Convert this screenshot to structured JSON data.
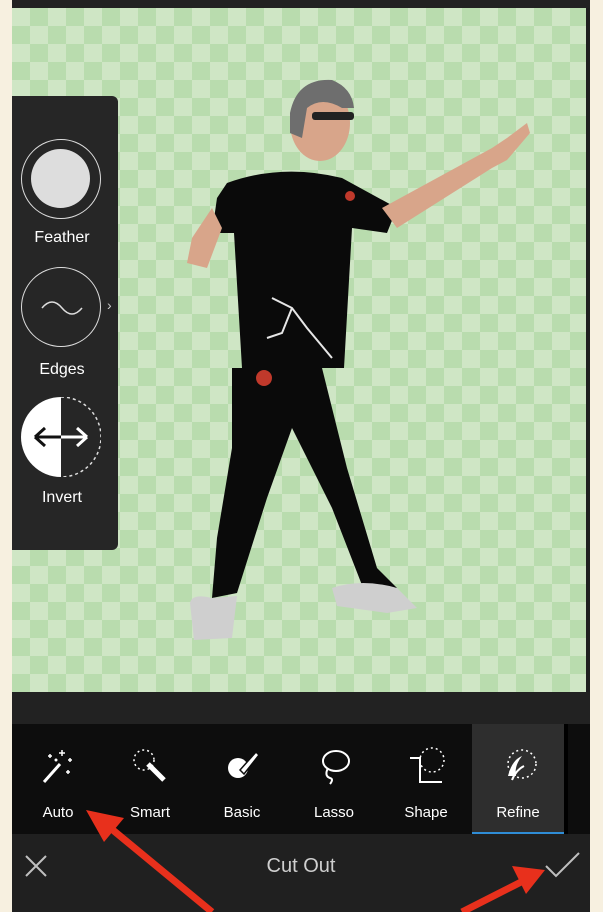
{
  "panel": {
    "feather_label": "Feather",
    "edges_label": "Edges",
    "invert_label": "Invert"
  },
  "tools": [
    {
      "label": "Auto",
      "icon": "magic-wand-sparkle-icon"
    },
    {
      "label": "Smart",
      "icon": "smart-wand-icon"
    },
    {
      "label": "Basic",
      "icon": "brush-icon"
    },
    {
      "label": "Lasso",
      "icon": "lasso-icon"
    },
    {
      "label": "Shape",
      "icon": "shape-select-icon"
    },
    {
      "label": "Refine",
      "icon": "refine-icon",
      "selected": true
    }
  ],
  "bottombar": {
    "title": "Cut Out"
  },
  "colors": {
    "accent": "#2f8dd6",
    "annotation_arrow": "#e8301c",
    "checker_light": "#cfe6c5",
    "checker_dark": "#b9dcae"
  }
}
